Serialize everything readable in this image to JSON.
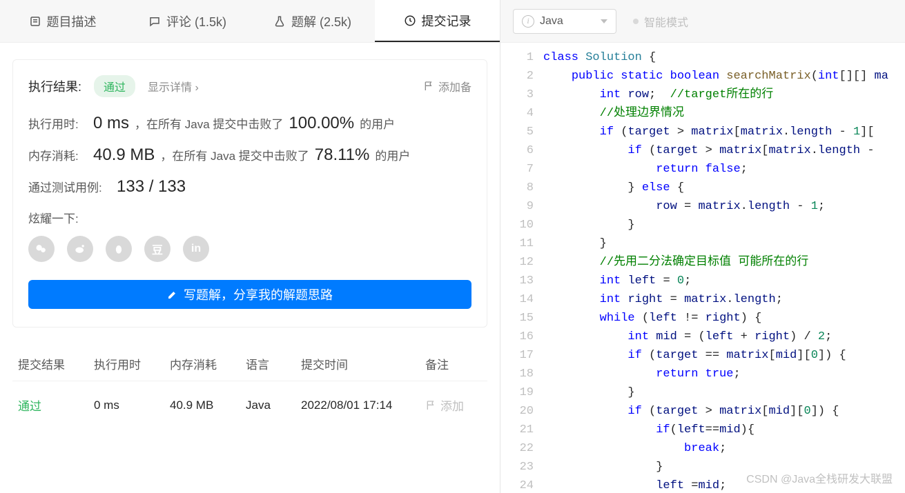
{
  "tabs": {
    "description": "题目描述",
    "comments": "评论 (1.5k)",
    "solutions": "题解 (2.5k)",
    "submissions": "提交记录"
  },
  "result": {
    "label": "执行结果:",
    "status": "通过",
    "show_detail": "显示详情 ›",
    "add_note": "添加备",
    "runtime_label": "执行用时:",
    "runtime_value": "0 ms",
    "runtime_text1": "，在所有 Java 提交中击败了",
    "runtime_percent": "100.00%",
    "runtime_text2": "的用户",
    "memory_label": "内存消耗:",
    "memory_value": "40.9 MB",
    "memory_text1": "，在所有 Java 提交中击败了",
    "memory_percent": "78.11%",
    "memory_text2": "的用户",
    "testcases_label": "通过测试用例:",
    "testcases_value": "133 / 133",
    "share_label": "炫耀一下:",
    "write_solution": "写题解，分享我的解题思路"
  },
  "history": {
    "headers": {
      "result": "提交结果",
      "time": "执行用时",
      "memory": "内存消耗",
      "lang": "语言",
      "date": "提交时间",
      "note": "备注"
    },
    "rows": [
      {
        "result": "通过",
        "time": "0 ms",
        "memory": "40.9 MB",
        "lang": "Java",
        "date": "2022/08/01 17:14",
        "note": "添加"
      }
    ]
  },
  "editor": {
    "lang": "Java",
    "smart_mode": "智能模式"
  },
  "watermark": "CSDN @Java全栈研发大联盟",
  "code": {
    "lines": 24
  }
}
